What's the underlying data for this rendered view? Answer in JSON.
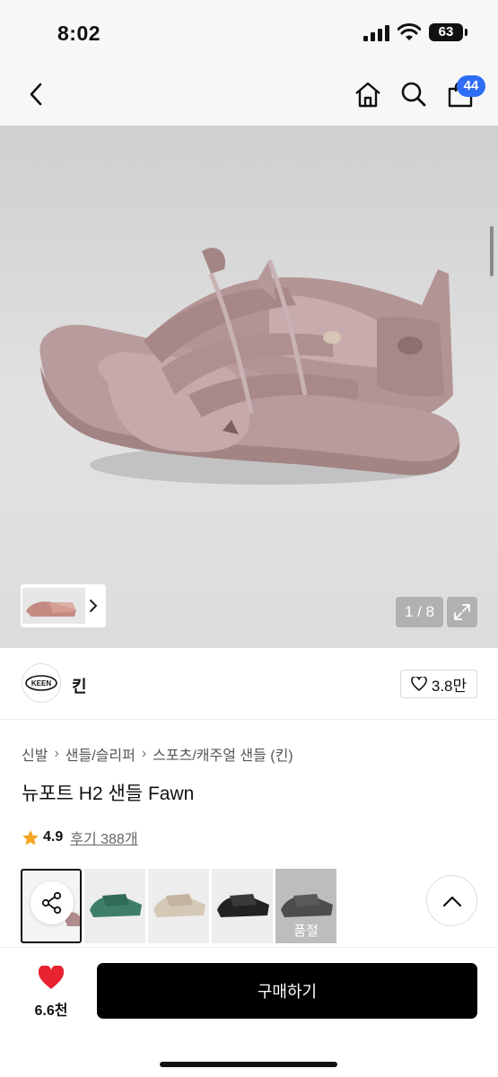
{
  "status_bar": {
    "time": "8:02",
    "battery": "63"
  },
  "header": {
    "cart_badge": "44"
  },
  "gallery": {
    "pager": "1 / 8"
  },
  "brand": {
    "name": "킨",
    "logo_text": "KEEN",
    "likes": "3.8만"
  },
  "product": {
    "breadcrumb": [
      "신발",
      "샌들/슬리퍼",
      "스포츠/캐주얼 샌들 (킨)"
    ],
    "title": "뉴포트 H2 샌들 Fawn",
    "rating": "4.9",
    "reviews": "후기 388개"
  },
  "options": {
    "colors": [
      "#b08c8e",
      "#3f7f6a",
      "#d6c8b7",
      "#222222",
      "#1f1f1f"
    ],
    "soldout_label": "품절"
  },
  "bottom": {
    "wish_count": "6.6천",
    "buy_label": "구매하기",
    "heart_color": "#e8222e"
  }
}
